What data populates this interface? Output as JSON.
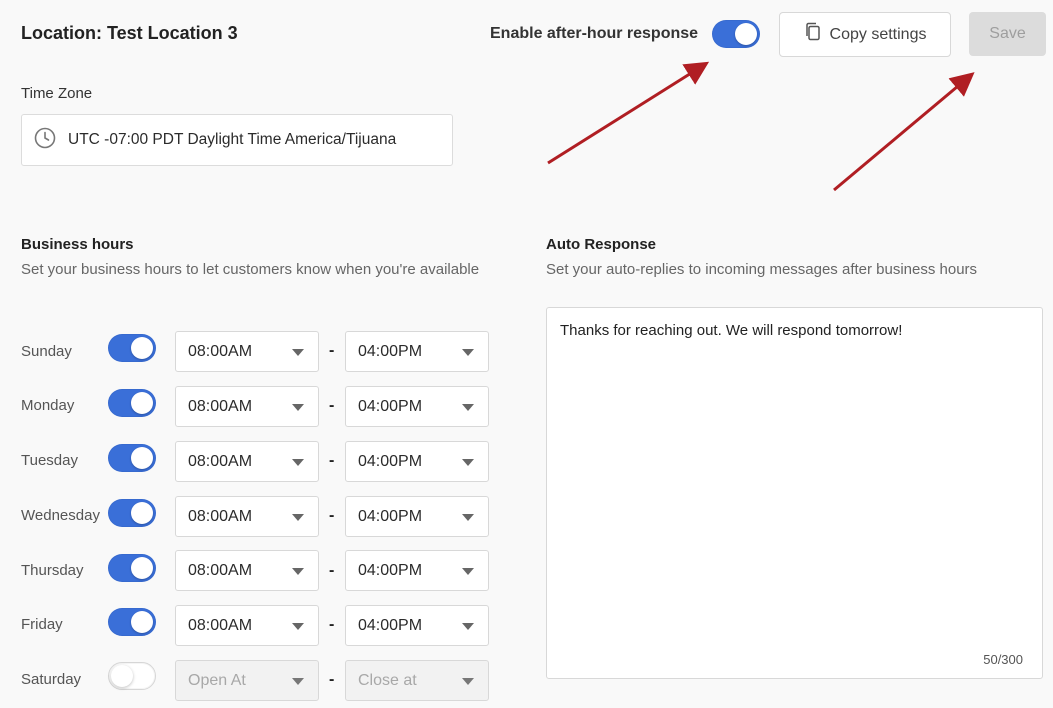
{
  "header": {
    "location_title": "Location: Test Location 3",
    "after_hour_label": "Enable after-hour response",
    "after_hour_enabled": true,
    "copy_settings_label": "Copy settings",
    "save_label": "Save"
  },
  "time_zone": {
    "label": "Time Zone",
    "value": "UTC -07:00 PDT Daylight Time America/Tijuana"
  },
  "business_hours": {
    "title": "Business hours",
    "description": "Set your business hours to let customers know when you're available",
    "separator": "-",
    "days": [
      {
        "name": "Sunday",
        "enabled": true,
        "open": "08:00AM",
        "close": "04:00PM"
      },
      {
        "name": "Monday",
        "enabled": true,
        "open": "08:00AM",
        "close": "04:00PM"
      },
      {
        "name": "Tuesday",
        "enabled": true,
        "open": "08:00AM",
        "close": "04:00PM"
      },
      {
        "name": "Wednesday",
        "enabled": true,
        "open": "08:00AM",
        "close": "04:00PM"
      },
      {
        "name": "Thursday",
        "enabled": true,
        "open": "08:00AM",
        "close": "04:00PM"
      },
      {
        "name": "Friday",
        "enabled": true,
        "open": "08:00AM",
        "close": "04:00PM"
      },
      {
        "name": "Saturday",
        "enabled": false,
        "open": "Open At",
        "close": "Close at"
      }
    ]
  },
  "auto_response": {
    "title": "Auto Response",
    "description": "Set your auto-replies to incoming messages after business hours",
    "message": "Thanks for reaching out. We will respond tomorrow!",
    "counter": "50/300"
  },
  "colors": {
    "toggle_on": "#3a6fd8",
    "annotation_arrow": "#b01e23"
  }
}
